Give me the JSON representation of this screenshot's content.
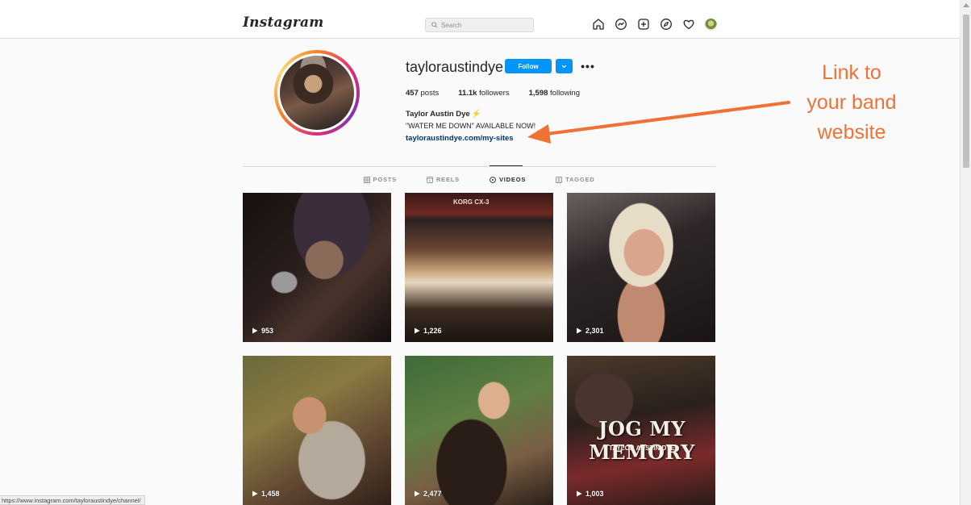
{
  "nav": {
    "logo": "Instagram",
    "search_placeholder": "Search",
    "icons": [
      "home-icon",
      "messenger-icon",
      "new-post-icon",
      "explore-icon",
      "activity-heart-icon",
      "profile-avatar"
    ]
  },
  "profile": {
    "username": "tayloraustindye",
    "follow_label": "Follow",
    "more_label": "•••",
    "stats": {
      "posts_count": "457",
      "posts_label": "posts",
      "followers_count": "11.1k",
      "followers_label": "followers",
      "following_count": "1,598",
      "following_label": "following"
    },
    "full_name": "Taylor Austin Dye",
    "bio": "\"WATER ME DOWN\" AVAILABLE NOW!",
    "link": "tayloraustindye.com/my-sites"
  },
  "annotation": {
    "line1": "Link to",
    "line2": "your band",
    "line3": "website",
    "color": "#ee7236"
  },
  "tabs": [
    {
      "label": "POSTS",
      "icon": "grid-icon",
      "active": false
    },
    {
      "label": "REELS",
      "icon": "reels-icon",
      "active": false
    },
    {
      "label": "VIDEOS",
      "icon": "video-icon",
      "active": true
    },
    {
      "label": "TAGGED",
      "icon": "tagged-icon",
      "active": false
    }
  ],
  "videos": [
    {
      "views": "953"
    },
    {
      "views": "1,226",
      "overlay_text": "KORG CX-3"
    },
    {
      "views": "2,301"
    },
    {
      "views": "1,458"
    },
    {
      "views": "2,477"
    },
    {
      "views": "1,003",
      "overlay_title": "JOG MY MEMORY",
      "overlay_subtitle": "TAYLOR AUSTIN DYE"
    }
  ],
  "status_bar": {
    "url": "https://www.instagram.com/tayloraustindye/channel/"
  },
  "colors": {
    "accent_blue": "#0095f6",
    "link_blue": "#00376b",
    "background": "#fafafa",
    "annotation_orange": "#ee7236"
  }
}
